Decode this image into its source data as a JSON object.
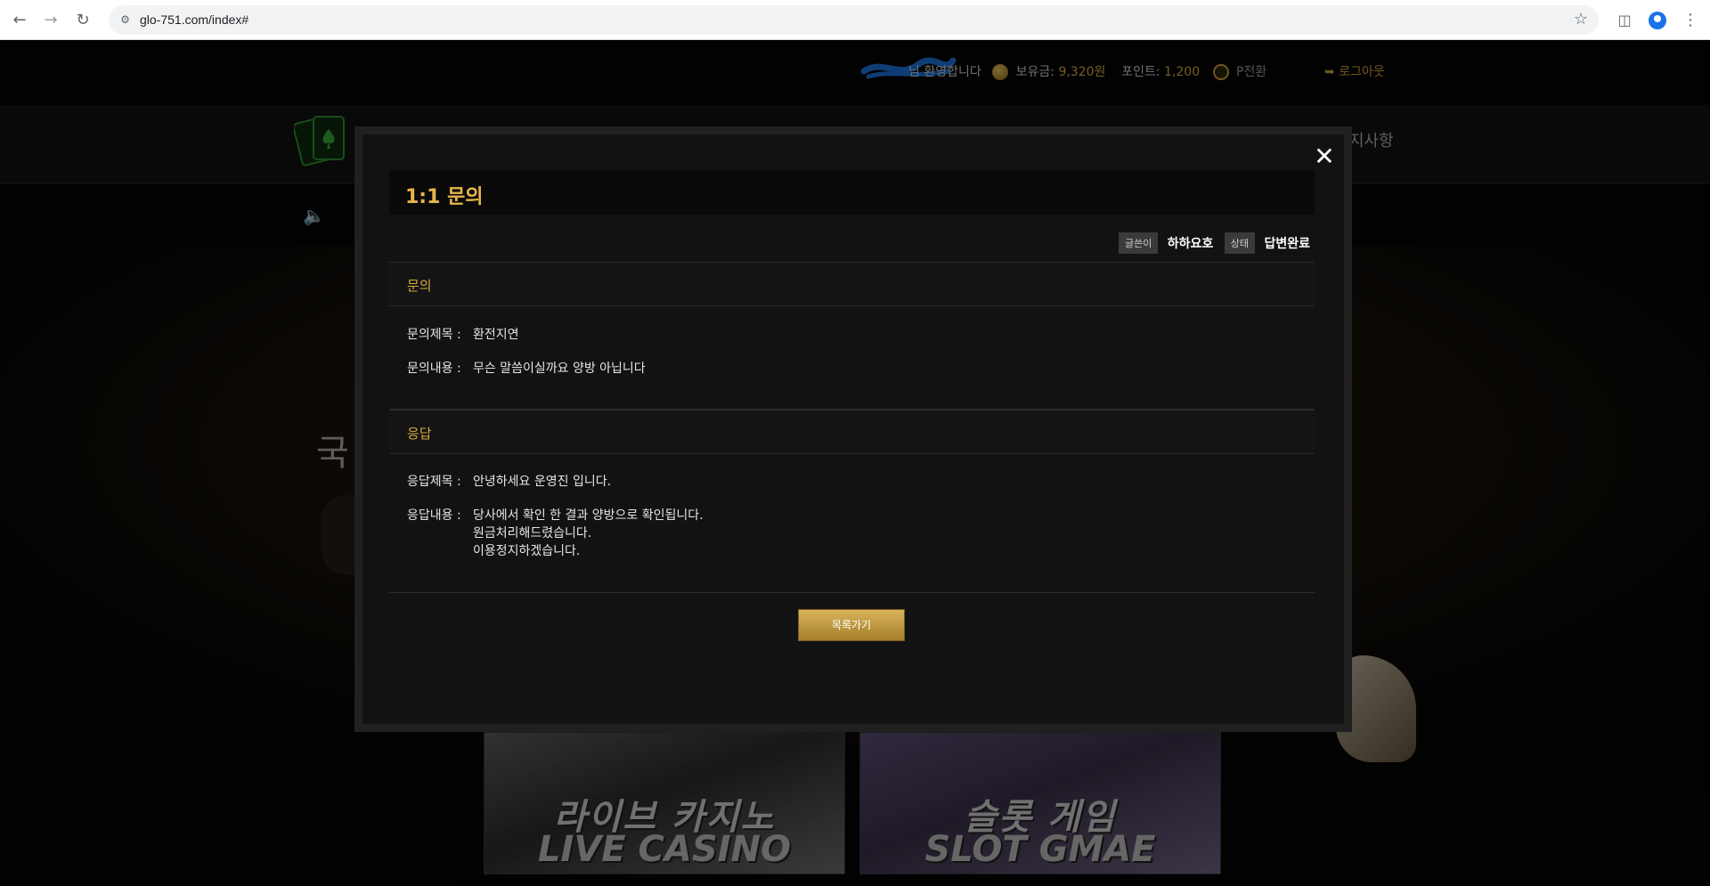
{
  "browser": {
    "url": "glo-751.com/index#"
  },
  "topbar": {
    "welcome": "님 환영합니다",
    "balance_label": "보유금:",
    "balance_value": "9,320원",
    "point_label": "포인트:",
    "point_value": "1,200",
    "point_convert": "P전환",
    "logout": "로그아웃"
  },
  "menu": {
    "notice_partial": "지사항"
  },
  "hero": {
    "text_partial": "국"
  },
  "banners": [
    {
      "kr": "라이브 카지노",
      "en": "LIVE CASINO"
    },
    {
      "kr": "슬롯 게임",
      "en": "SLOT GMAE"
    }
  ],
  "modal": {
    "title": "1:1 문의",
    "writer_tag": "글쓴이",
    "writer": "하하요호",
    "status_tag": "상태",
    "status": "답변완료",
    "inquiry": {
      "heading": "문의",
      "subject_label": "문의제목 :",
      "subject": "환전지연",
      "content_label": "문의내용 :",
      "content": "무슨 말씀이실까요 양방 아닙니다"
    },
    "answer": {
      "heading": "응답",
      "subject_label": "응답제목 :",
      "subject": "안녕하세요 운영진 입니다.",
      "content_label": "응답내용 :",
      "content_lines": [
        "당사에서 확인 한 결과 양방으로 확인됩니다.",
        "원금처리해드렸습니다.",
        "이용정지하겠습니다."
      ]
    },
    "list_button": "목록가기"
  },
  "colors": {
    "accent_gold": "#d5a93f",
    "title_gold": "#e8b54a"
  }
}
